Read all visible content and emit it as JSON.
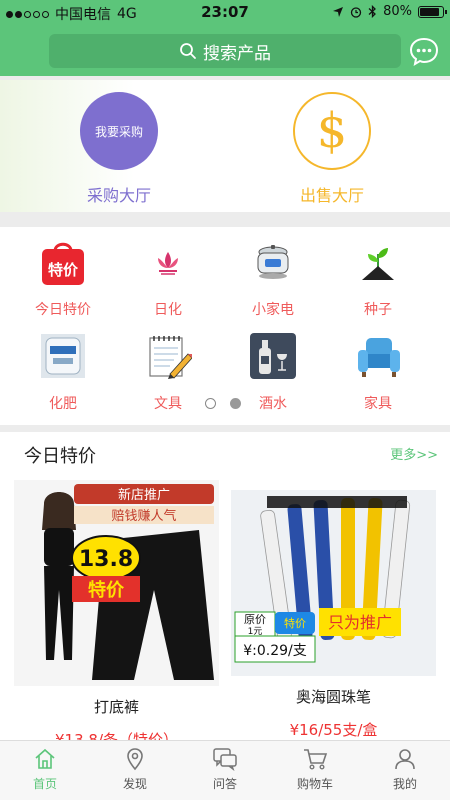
{
  "status": {
    "carrier": "中国电信",
    "network": "4G",
    "time": "23:07",
    "battery": "80%"
  },
  "header": {
    "search_placeholder": "搜索产品",
    "chat_icon": "chat-bubble-icon",
    "accent": "#5cc57a"
  },
  "hall": {
    "buy_circle": "我要采购",
    "buy_label": "采购大厅",
    "sell_label": "出售大厅",
    "buy_color": "#7e6fcf",
    "sell_color": "#f5b72b"
  },
  "categories": [
    {
      "label": "今日特价",
      "icon_text": "特价"
    },
    {
      "label": "日化"
    },
    {
      "label": "小家电"
    },
    {
      "label": "种子"
    },
    {
      "label": "化肥"
    },
    {
      "label": "文具"
    },
    {
      "label": "酒水"
    },
    {
      "label": "家具"
    }
  ],
  "pager": {
    "pages": 2,
    "active": 2
  },
  "special": {
    "title": "今日特价",
    "more": "更多>>",
    "products": [
      {
        "name": "打底裤",
        "price": "¥13.8/条（特价）",
        "img_text": {
          "top1": "新店推广",
          "top2": "赔钱赚人气",
          "tag1": "13.8",
          "tag2": "特价"
        }
      },
      {
        "name": "奥海圆珠笔",
        "price": "¥16/55支/盒",
        "img_text": {
          "orig": "原价",
          "orig_val": "1元",
          "tag": "特价",
          "price": "¥:0.29/支",
          "promo": "只为推广"
        }
      }
    ]
  },
  "tabbar": [
    {
      "label": "首页",
      "icon": "home-icon",
      "active": true
    },
    {
      "label": "发现",
      "icon": "location-pin-icon",
      "active": false
    },
    {
      "label": "问答",
      "icon": "chat-icon",
      "active": false
    },
    {
      "label": "购物车",
      "icon": "cart-icon",
      "active": false
    },
    {
      "label": "我的",
      "icon": "user-icon",
      "active": false
    }
  ]
}
